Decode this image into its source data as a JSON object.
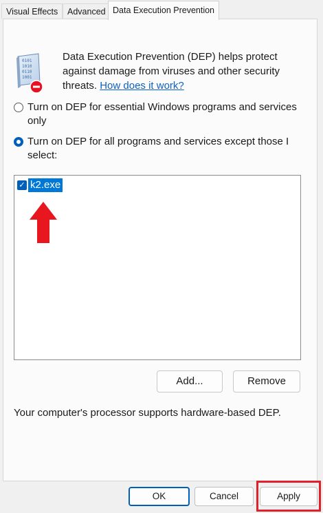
{
  "tabs": [
    {
      "label": "Visual Effects"
    },
    {
      "label": "Advanced"
    },
    {
      "label": "Data Execution Prevention"
    }
  ],
  "description": {
    "text": "Data Execution Prevention (DEP) helps protect against damage from viruses and other security threats. ",
    "link": "How does it work?"
  },
  "options": [
    {
      "label": "Turn on DEP for essential Windows programs and services only",
      "selected": false
    },
    {
      "label": "Turn on DEP for all programs and services except those I select:",
      "selected": true
    }
  ],
  "exceptions_list": {
    "items": [
      {
        "label": "k2.exe",
        "checked": true,
        "selected": true
      }
    ]
  },
  "buttons": {
    "add": "Add...",
    "remove": "Remove"
  },
  "status_text": "Your computer's processor supports hardware-based DEP.",
  "dialog_buttons": {
    "ok": "OK",
    "cancel": "Cancel",
    "apply": "Apply"
  },
  "annotations": {
    "arrow_color": "#e8161e",
    "highlight_color": "#e0202a"
  }
}
